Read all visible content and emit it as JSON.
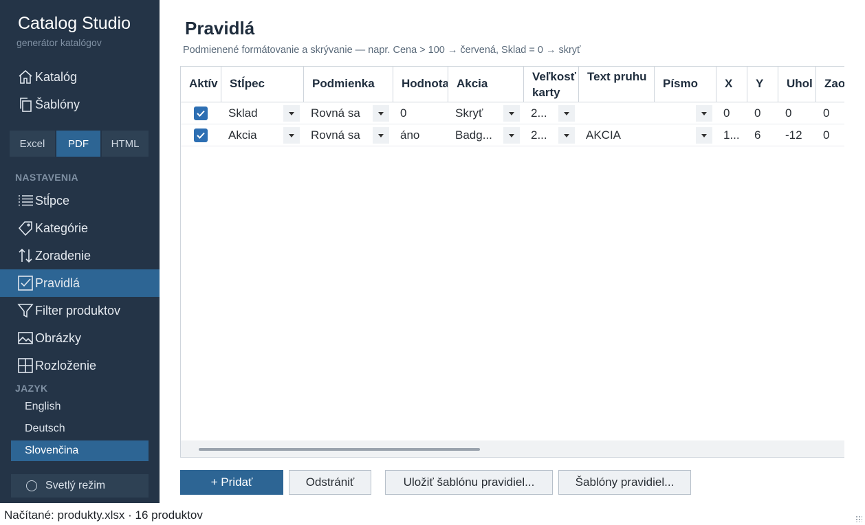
{
  "app": {
    "title": "Catalog Studio",
    "subtitle": "generátor katalógov"
  },
  "nav_top": [
    {
      "label": "Katalóg",
      "icon": "home-icon"
    },
    {
      "label": "Šablóny",
      "icon": "copy-icon"
    }
  ],
  "formats": [
    {
      "label": "Excel",
      "active": false
    },
    {
      "label": "PDF",
      "active": true
    },
    {
      "label": "HTML",
      "active": false
    }
  ],
  "settings": {
    "label": "NASTAVENIA",
    "items": [
      {
        "label": "Stĺpce",
        "icon": "list-icon",
        "active": false
      },
      {
        "label": "Kategórie",
        "icon": "tag-icon",
        "active": false
      },
      {
        "label": "Zoradenie",
        "icon": "sort-icon",
        "active": false
      },
      {
        "label": "Pravidlá",
        "icon": "checkbox-icon",
        "active": true
      },
      {
        "label": "Filter produktov",
        "icon": "filter-icon",
        "active": false
      },
      {
        "label": "Obrázky",
        "icon": "image-icon",
        "active": false
      },
      {
        "label": "Rozloženie",
        "icon": "layout-icon",
        "active": false
      }
    ]
  },
  "language": {
    "label": "JAZYK",
    "items": [
      {
        "label": "English",
        "active": false
      },
      {
        "label": "Deutsch",
        "active": false
      },
      {
        "label": "Slovenčina",
        "active": true
      }
    ]
  },
  "theme_toggle": {
    "label": "Svetlý režim",
    "icon": "sun-icon"
  },
  "page": {
    "title": "Pravidlá",
    "description": "Podmienené formátovanie a skrývanie — napr. Cena > 100 → červená, Sklad = 0 → skryť"
  },
  "table": {
    "columns": [
      "Aktív",
      "Stĺpec",
      "Podmienka",
      "Hodnota",
      "Akcia",
      "Veľkosť karty",
      "Text pruhu",
      "Písmo",
      "X",
      "Y",
      "Uhol",
      "Zaoblenie"
    ],
    "rows": [
      {
        "active": true,
        "column": "Sklad",
        "condition": "Rovná sa",
        "value": "0",
        "action": "Skryť",
        "card_size": "2...",
        "band_text": "",
        "font": "",
        "x": "0",
        "y": "0",
        "angle": "0",
        "rounding": "0"
      },
      {
        "active": true,
        "column": "Akcia",
        "condition": "Rovná sa",
        "value": "áno",
        "action": "Badg...",
        "card_size": "2...",
        "band_text": "AKCIA",
        "font": "",
        "x": "1...",
        "y": "6",
        "angle": "-12",
        "rounding": "0"
      }
    ]
  },
  "buttons": {
    "add": "+  Pridať",
    "remove": "Odstrániť",
    "save_template": "Uložiť šablónu pravidiel...",
    "templates": "Šablóny pravidiel..."
  },
  "status": {
    "text": "Načítané: produkty.xlsx · 16 produktov"
  },
  "colors": {
    "sidebar": "#243447",
    "accent": "#2d6594",
    "checkbox": "#2d6fb3"
  }
}
